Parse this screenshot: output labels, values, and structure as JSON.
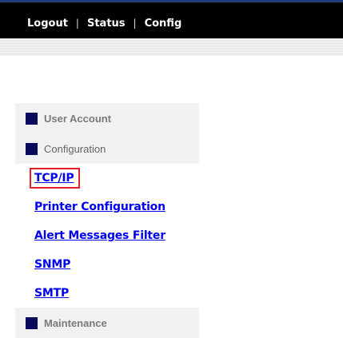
{
  "topnav": {
    "logout": "Logout",
    "status": "Status",
    "config": "Config",
    "separator": "|"
  },
  "sidebar": {
    "sections": [
      {
        "label": "User Account"
      },
      {
        "label": "Configuration"
      },
      {
        "label": "Maintenance"
      }
    ],
    "config_items": [
      {
        "label": "TCP/IP",
        "selected": true
      },
      {
        "label": "Printer Configuration"
      },
      {
        "label": "Alert Messages Filter"
      },
      {
        "label": "SNMP"
      },
      {
        "label": "SMTP"
      }
    ]
  },
  "colors": {
    "header_bg": "#000000",
    "section_bg": "#f1f1f1",
    "section_marker": "#0b0b5e",
    "link": "#0000ee",
    "highlight_border": "#e8202a"
  },
  "icons": {
    "section_marker": "square-bullet-icon"
  }
}
